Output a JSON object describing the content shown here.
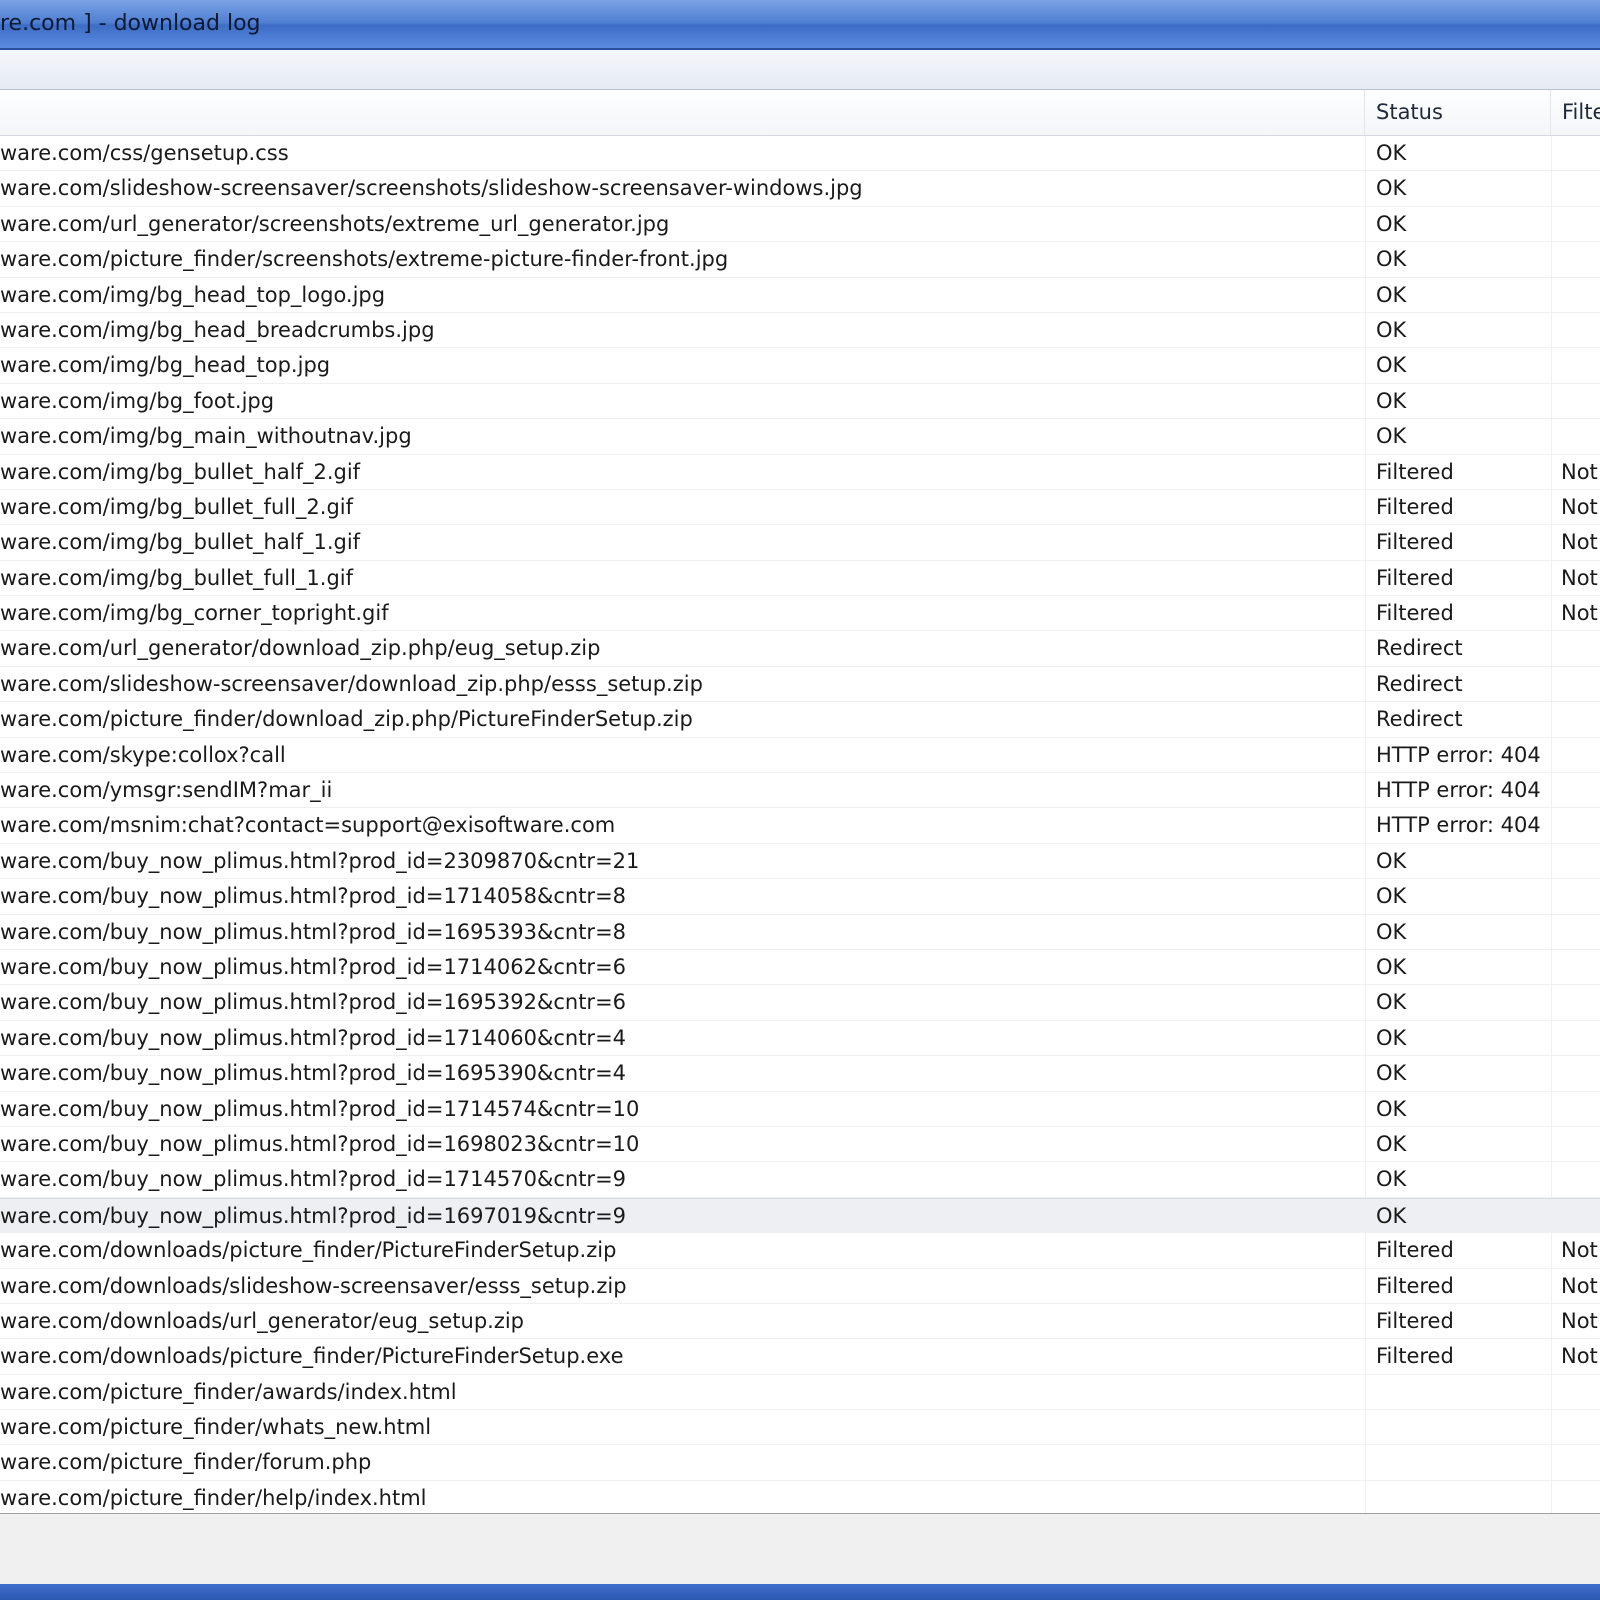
{
  "window": {
    "title": "re.com ] - download log"
  },
  "columns": {
    "url": "",
    "status": "Status",
    "filter": "Filte"
  },
  "rows": [
    {
      "url": "ware.com/css/gensetup.css",
      "status": "OK",
      "filter": ""
    },
    {
      "url": "ware.com/slideshow-screensaver/screenshots/slideshow-screensaver-windows.jpg",
      "status": "OK",
      "filter": ""
    },
    {
      "url": "ware.com/url_generator/screenshots/extreme_url_generator.jpg",
      "status": "OK",
      "filter": ""
    },
    {
      "url": "ware.com/picture_finder/screenshots/extreme-picture-finder-front.jpg",
      "status": "OK",
      "filter": ""
    },
    {
      "url": "ware.com/img/bg_head_top_logo.jpg",
      "status": "OK",
      "filter": ""
    },
    {
      "url": "ware.com/img/bg_head_breadcrumbs.jpg",
      "status": "OK",
      "filter": ""
    },
    {
      "url": "ware.com/img/bg_head_top.jpg",
      "status": "OK",
      "filter": ""
    },
    {
      "url": "ware.com/img/bg_foot.jpg",
      "status": "OK",
      "filter": ""
    },
    {
      "url": "ware.com/img/bg_main_withoutnav.jpg",
      "status": "OK",
      "filter": ""
    },
    {
      "url": "ware.com/img/bg_bullet_half_2.gif",
      "status": "Filtered",
      "filter": "Not"
    },
    {
      "url": "ware.com/img/bg_bullet_full_2.gif",
      "status": "Filtered",
      "filter": "Not"
    },
    {
      "url": "ware.com/img/bg_bullet_half_1.gif",
      "status": "Filtered",
      "filter": "Not"
    },
    {
      "url": "ware.com/img/bg_bullet_full_1.gif",
      "status": "Filtered",
      "filter": "Not"
    },
    {
      "url": "ware.com/img/bg_corner_topright.gif",
      "status": "Filtered",
      "filter": "Not"
    },
    {
      "url": "ware.com/url_generator/download_zip.php/eug_setup.zip",
      "status": "Redirect",
      "filter": ""
    },
    {
      "url": "ware.com/slideshow-screensaver/download_zip.php/esss_setup.zip",
      "status": "Redirect",
      "filter": ""
    },
    {
      "url": "ware.com/picture_finder/download_zip.php/PictureFinderSetup.zip",
      "status": "Redirect",
      "filter": ""
    },
    {
      "url": "ware.com/skype:collox?call",
      "status": "HTTP error: 404",
      "filter": ""
    },
    {
      "url": "ware.com/ymsgr:sendIM?mar_ii",
      "status": "HTTP error: 404",
      "filter": ""
    },
    {
      "url": "ware.com/msnim:chat?contact=support@exisoftware.com",
      "status": "HTTP error: 404",
      "filter": ""
    },
    {
      "url": "ware.com/buy_now_plimus.html?prod_id=2309870&cntr=21",
      "status": "OK",
      "filter": ""
    },
    {
      "url": "ware.com/buy_now_plimus.html?prod_id=1714058&cntr=8",
      "status": "OK",
      "filter": ""
    },
    {
      "url": "ware.com/buy_now_plimus.html?prod_id=1695393&cntr=8",
      "status": "OK",
      "filter": ""
    },
    {
      "url": "ware.com/buy_now_plimus.html?prod_id=1714062&cntr=6",
      "status": "OK",
      "filter": ""
    },
    {
      "url": "ware.com/buy_now_plimus.html?prod_id=1695392&cntr=6",
      "status": "OK",
      "filter": ""
    },
    {
      "url": "ware.com/buy_now_plimus.html?prod_id=1714060&cntr=4",
      "status": "OK",
      "filter": ""
    },
    {
      "url": "ware.com/buy_now_plimus.html?prod_id=1695390&cntr=4",
      "status": "OK",
      "filter": ""
    },
    {
      "url": "ware.com/buy_now_plimus.html?prod_id=1714574&cntr=10",
      "status": "OK",
      "filter": ""
    },
    {
      "url": "ware.com/buy_now_plimus.html?prod_id=1698023&cntr=10",
      "status": "OK",
      "filter": ""
    },
    {
      "url": "ware.com/buy_now_plimus.html?prod_id=1714570&cntr=9",
      "status": "OK",
      "filter": ""
    },
    {
      "url": "ware.com/buy_now_plimus.html?prod_id=1697019&cntr=9",
      "status": "OK",
      "filter": "",
      "selected": true
    },
    {
      "url": "ware.com/downloads/picture_finder/PictureFinderSetup.zip",
      "status": "Filtered",
      "filter": "Not"
    },
    {
      "url": "ware.com/downloads/slideshow-screensaver/esss_setup.zip",
      "status": "Filtered",
      "filter": "Not"
    },
    {
      "url": "ware.com/downloads/url_generator/eug_setup.zip",
      "status": "Filtered",
      "filter": "Not"
    },
    {
      "url": "ware.com/downloads/picture_finder/PictureFinderSetup.exe",
      "status": "Filtered",
      "filter": "Not"
    },
    {
      "url": "ware.com/picture_finder/awards/index.html",
      "status": "",
      "filter": ""
    },
    {
      "url": "ware.com/picture_finder/whats_new.html",
      "status": "",
      "filter": ""
    },
    {
      "url": "ware.com/picture_finder/forum.php",
      "status": "",
      "filter": ""
    },
    {
      "url": "ware.com/picture_finder/help/index.html",
      "status": "",
      "filter": ""
    }
  ]
}
